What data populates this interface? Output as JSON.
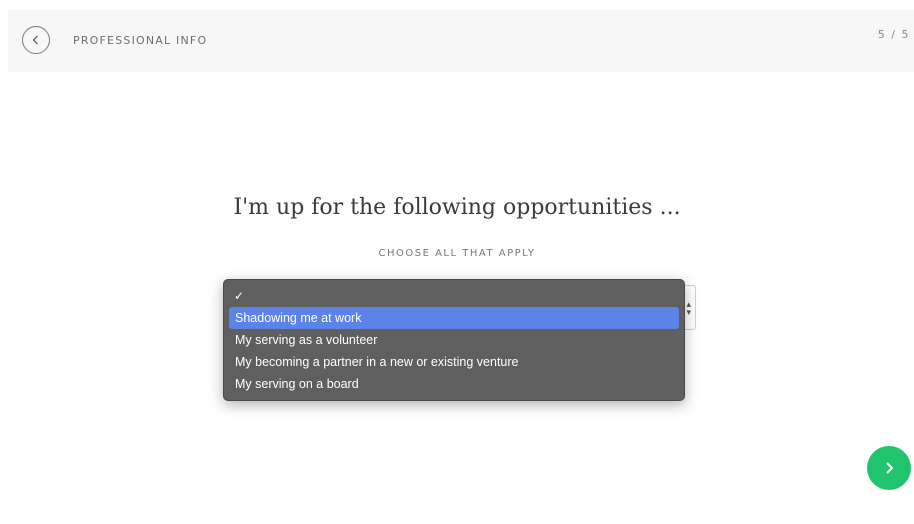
{
  "header": {
    "section_title": "PROFESSIONAL INFO",
    "step": "5 / 5",
    "back_icon": "chevron-left-icon"
  },
  "main": {
    "question": "I'm up for the following opportunities ...",
    "subhead": "CHOOSE ALL THAT APPLY"
  },
  "dropdown": {
    "blank_checkmark": "✓",
    "options": [
      "Shadowing me at work",
      "My serving as a volunteer",
      "My becoming a partner in a new or existing venture",
      "My serving on a board"
    ],
    "highlighted_option": "Shadowing me at work"
  },
  "footer": {
    "next_icon": "chevron-right-icon"
  },
  "colors": {
    "accent_green": "#20c46e",
    "highlight_blue": "#5b83e8",
    "menu_bg": "#5f5f5f"
  }
}
